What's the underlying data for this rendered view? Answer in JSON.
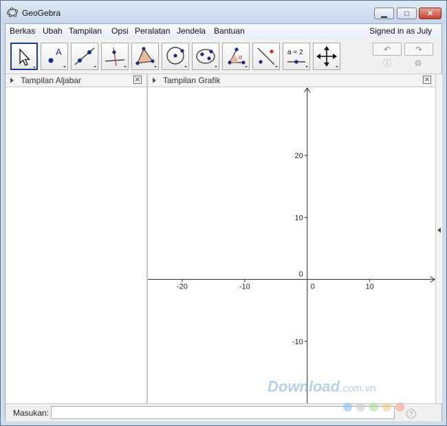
{
  "window": {
    "title": "GeoGebra"
  },
  "menu": {
    "items": [
      "Berkas",
      "Ubah",
      "Tampilan",
      "Opsi",
      "Peralatan",
      "Jendela",
      "Bantuan"
    ],
    "signed_in": "Signed in as July"
  },
  "toolbar": {
    "tools": [
      {
        "icon": "move-arrow-icon",
        "active": true
      },
      {
        "icon": "point-icon",
        "glyph": "A"
      },
      {
        "icon": "line-through-two-points-icon"
      },
      {
        "icon": "perpendicular-line-icon"
      },
      {
        "icon": "polygon-icon"
      },
      {
        "icon": "circle-center-point-icon"
      },
      {
        "icon": "ellipse-icon"
      },
      {
        "icon": "angle-icon",
        "glyph": "α"
      },
      {
        "icon": "reflect-about-line-icon"
      },
      {
        "icon": "slider-icon",
        "glyph": "a = 2"
      },
      {
        "icon": "move-graphics-view-icon"
      }
    ],
    "undo_icon": "undo-icon",
    "redo_icon": "redo-icon",
    "help_icon": "help-icon",
    "settings_icon": "gear-icon"
  },
  "algebra_view": {
    "title": "Tampilan Aljabar"
  },
  "graphics_view": {
    "title": "Tampilan Grafik",
    "x_ticks": [
      {
        "value": -20,
        "label": "-20"
      },
      {
        "value": -10,
        "label": "-10"
      },
      {
        "value": 0,
        "label": "0"
      },
      {
        "value": 10,
        "label": "10"
      }
    ],
    "y_ticks": [
      {
        "value": 20,
        "label": "20"
      },
      {
        "value": 10,
        "label": "10"
      },
      {
        "value": 0,
        "label": "0"
      },
      {
        "value": -10,
        "label": "-10"
      }
    ],
    "x_range": [
      -25.5,
      20.5
    ],
    "y_range": [
      -20,
      31
    ]
  },
  "input_bar": {
    "label": "Masukan:",
    "value": "",
    "placeholder": ""
  },
  "watermark": {
    "text": "Download",
    "suffix": ".com.vn"
  },
  "colors": {
    "accent": "#1f3d8f",
    "point": "#1a2d86",
    "polygon_fill": "#e8b8a0",
    "close_button": "#c8432f",
    "watermark": "#78aad7",
    "dots": [
      "#7fb8e6",
      "#c9c9c9",
      "#a8d89a",
      "#f5c77a",
      "#f29a7d"
    ]
  }
}
